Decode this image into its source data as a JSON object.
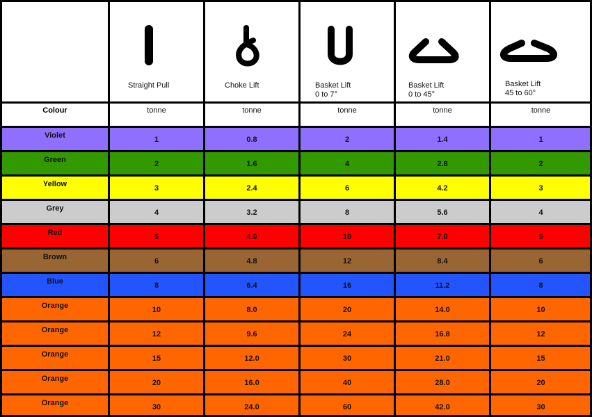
{
  "header": {
    "columns": [
      {
        "icon": "straight-pull-icon",
        "label_lines": [
          "Straight Pull"
        ]
      },
      {
        "icon": "choke-lift-icon",
        "label_lines": [
          "Choke Lift"
        ]
      },
      {
        "icon": "basket-lift-vertical-icon",
        "label_lines": [
          "Basket Lift",
          "0 to 7°"
        ]
      },
      {
        "icon": "basket-lift-45-icon",
        "label_lines": [
          "Basket Lift",
          "0 to 45°"
        ]
      },
      {
        "icon": "basket-lift-60-icon",
        "label_lines": [
          "Basket Lift",
          "45 to 60°"
        ]
      }
    ],
    "colour_label": "Colour",
    "units": [
      "tonne",
      "tonne",
      "tonne",
      "tonne",
      "tonne"
    ]
  },
  "rows": [
    {
      "colour": "Violet",
      "hex": "#8f6ffe",
      "values": [
        "1",
        "0.8",
        "2",
        "1.4",
        "1"
      ]
    },
    {
      "colour": "Green",
      "hex": "#339900",
      "values": [
        "2",
        "1.6",
        "4",
        "2.8",
        "2"
      ]
    },
    {
      "colour": "Yellow",
      "hex": "#ffff00",
      "values": [
        "3",
        "2.4",
        "6",
        "4.2",
        "3"
      ]
    },
    {
      "colour": "Grey",
      "hex": "#cccccc",
      "values": [
        "4",
        "3.2",
        "8",
        "5.6",
        "4"
      ]
    },
    {
      "colour": "Red",
      "hex": "#ff0000",
      "values": [
        "5",
        "4.0",
        "10",
        "7.0",
        "5"
      ]
    },
    {
      "colour": "Brown",
      "hex": "#996633",
      "values": [
        "6",
        "4.8",
        "12",
        "8.4",
        "6"
      ]
    },
    {
      "colour": "Blue",
      "hex": "#2255ff",
      "values": [
        "8",
        "6.4",
        "16",
        "11.2",
        "8"
      ]
    },
    {
      "colour": "Orange",
      "hex": "#ff6600",
      "values": [
        "10",
        "8.0",
        "20",
        "14.0",
        "10"
      ]
    },
    {
      "colour": "Orange",
      "hex": "#ff6600",
      "values": [
        "12",
        "9.6",
        "24",
        "16.8",
        "12"
      ]
    },
    {
      "colour": "Orange",
      "hex": "#ff6600",
      "values": [
        "15",
        "12.0",
        "30",
        "21.0",
        "15"
      ]
    },
    {
      "colour": "Orange",
      "hex": "#ff6600",
      "values": [
        "20",
        "16.0",
        "40",
        "28.0",
        "20"
      ]
    },
    {
      "colour": "Orange",
      "hex": "#ff6600",
      "values": [
        "30",
        "24.0",
        "60",
        "42.0",
        "30"
      ]
    }
  ]
}
